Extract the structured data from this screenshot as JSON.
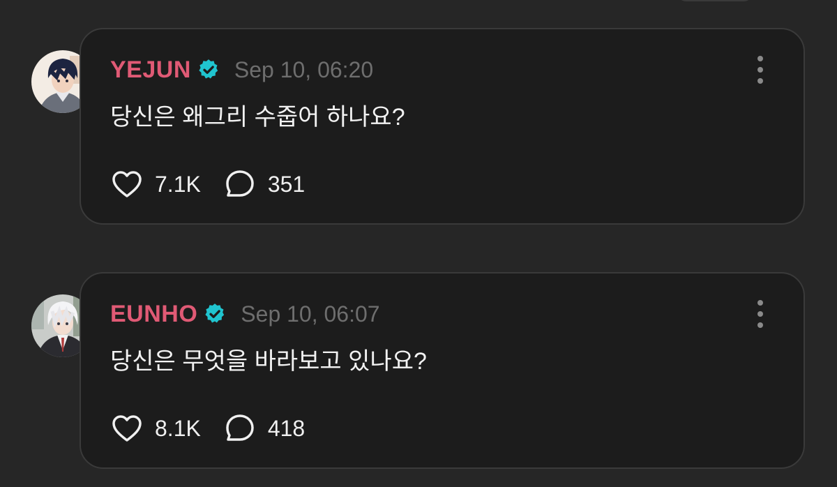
{
  "posts": [
    {
      "username": "YEJUN",
      "timestamp": "Sep 10, 06:20",
      "text": "당신은 왜그리 수줍어 하나요?",
      "likes": "7.1K",
      "replies": "351",
      "avatar": "yejun-avatar",
      "verified": true
    },
    {
      "username": "EUNHO",
      "timestamp": "Sep 10, 06:07",
      "text": "당신은 무엇을 바라보고 있나요?",
      "likes": "8.1K",
      "replies": "418",
      "avatar": "eunho-avatar",
      "verified": true
    }
  ],
  "colors": {
    "background": "#262626",
    "card": "#1c1c1c",
    "username": "#e05a75",
    "verified": "#20c4cf",
    "timestamp": "#6e6e6e"
  },
  "icons": {
    "like": "heart-icon",
    "reply": "speech-bubble-icon",
    "more": "more-vertical-icon",
    "verified": "verified-badge-icon"
  }
}
